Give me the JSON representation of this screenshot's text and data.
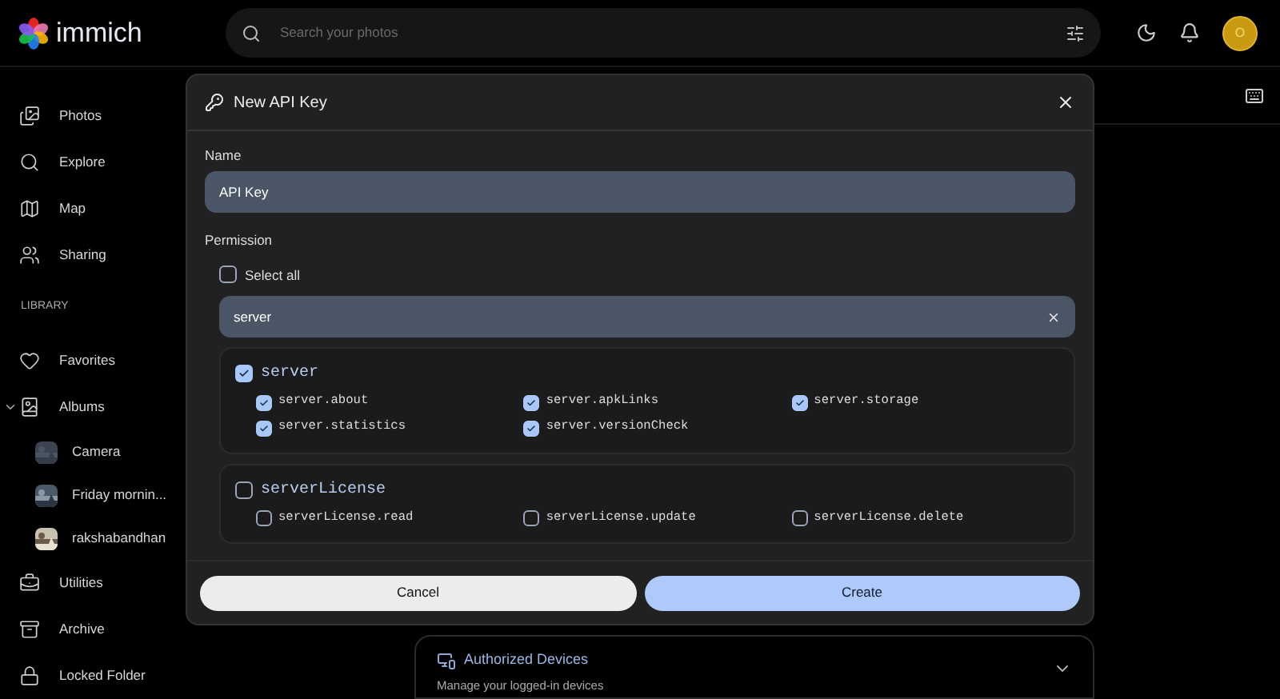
{
  "app": {
    "name": "immich"
  },
  "search": {
    "placeholder": "Search your photos"
  },
  "avatar": {
    "initial": "O"
  },
  "sidebar": {
    "items": [
      {
        "label": "Photos"
      },
      {
        "label": "Explore"
      },
      {
        "label": "Map"
      },
      {
        "label": "Sharing"
      }
    ],
    "section": "LIBRARY",
    "library": [
      {
        "label": "Favorites"
      },
      {
        "label": "Albums",
        "expanded": true,
        "children": [
          {
            "label": "Camera"
          },
          {
            "label": "Friday mornin..."
          },
          {
            "label": "rakshabandhan"
          }
        ]
      },
      {
        "label": "Utilities"
      },
      {
        "label": "Archive"
      },
      {
        "label": "Locked Folder"
      }
    ]
  },
  "background_card": {
    "title": "Authorized Devices",
    "subtitle": "Manage your logged-in devices",
    "expanded": false
  },
  "dialog": {
    "title": "New API Key",
    "name_label": "Name",
    "name_value": "API Key",
    "permission_label": "Permission",
    "select_all": {
      "label": "Select all",
      "checked": false
    },
    "filter_value": "server",
    "groups": [
      {
        "name": "server",
        "checked": true,
        "permissions": [
          {
            "name": "server.about",
            "checked": true
          },
          {
            "name": "server.apkLinks",
            "checked": true
          },
          {
            "name": "server.storage",
            "checked": true
          },
          {
            "name": "server.statistics",
            "checked": true
          },
          {
            "name": "server.versionCheck",
            "checked": true
          }
        ]
      },
      {
        "name": "serverLicense",
        "checked": false,
        "permissions": [
          {
            "name": "serverLicense.read",
            "checked": false
          },
          {
            "name": "serverLicense.update",
            "checked": false
          },
          {
            "name": "serverLicense.delete",
            "checked": false
          }
        ]
      }
    ],
    "buttons": [
      {
        "label": "Cancel",
        "kind": "secondary"
      },
      {
        "label": "Create",
        "kind": "primary"
      }
    ]
  }
}
